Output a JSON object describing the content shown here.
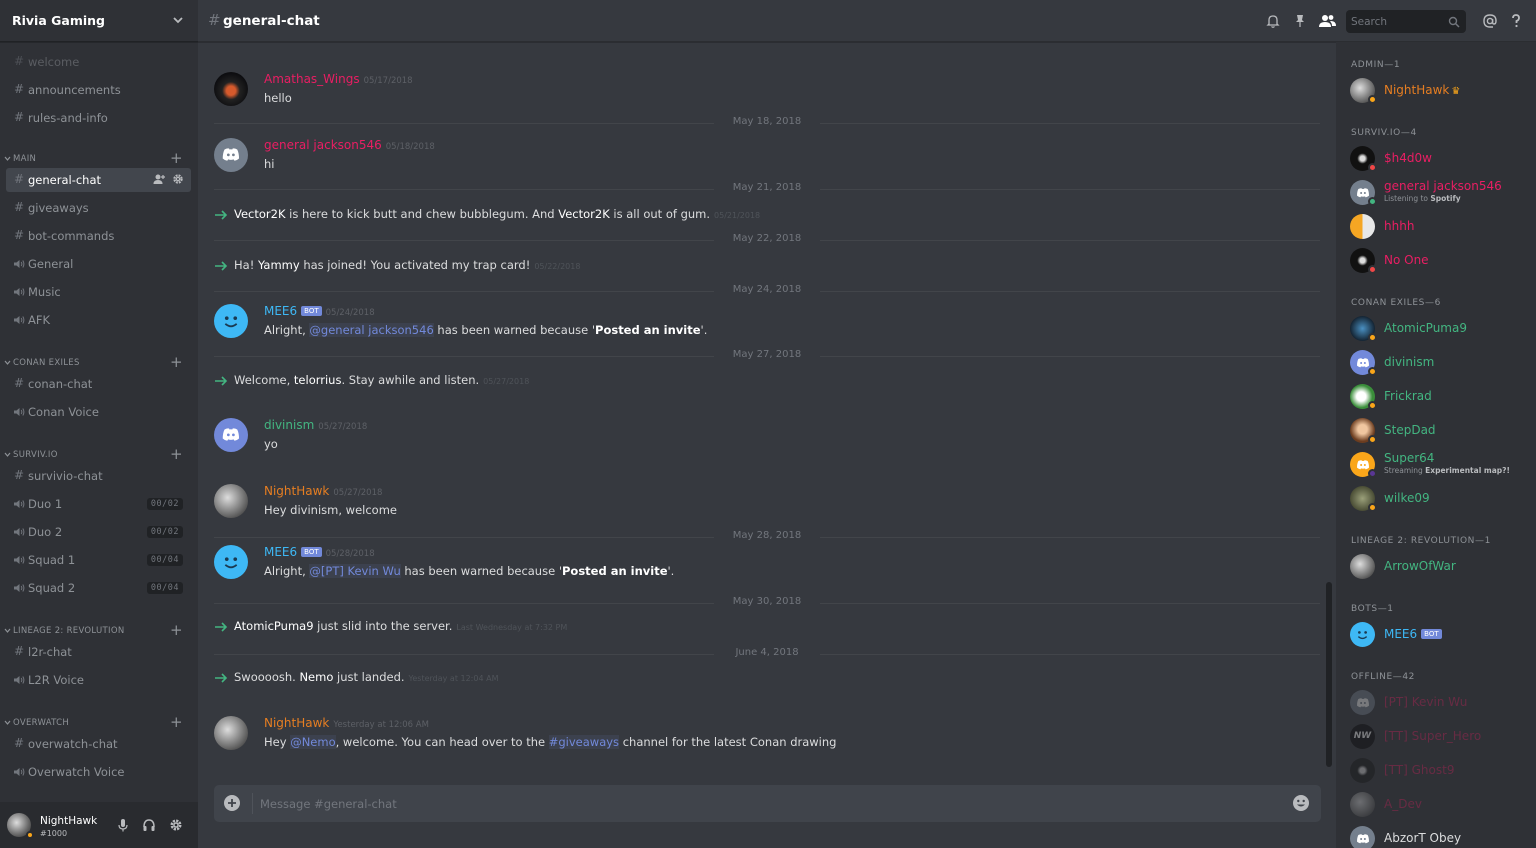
{
  "server": {
    "name": "Rivia Gaming"
  },
  "sidebar": {
    "partial_channel": "welcome",
    "top_channels": [
      {
        "name": "announcements",
        "type": "text"
      },
      {
        "name": "rules-and-info",
        "type": "text"
      }
    ],
    "categories": [
      {
        "name": "MAIN",
        "channels": [
          {
            "name": "general-chat",
            "type": "text",
            "active": true
          },
          {
            "name": "giveaways",
            "type": "text"
          },
          {
            "name": "bot-commands",
            "type": "text"
          },
          {
            "name": "General",
            "type": "voice"
          },
          {
            "name": "Music",
            "type": "voice"
          },
          {
            "name": "AFK",
            "type": "voice"
          }
        ]
      },
      {
        "name": "CONAN EXILES",
        "channels": [
          {
            "name": "conan-chat",
            "type": "text"
          },
          {
            "name": "Conan Voice",
            "type": "voice"
          }
        ]
      },
      {
        "name": "SURVIV.IO",
        "channels": [
          {
            "name": "survivio-chat",
            "type": "text"
          },
          {
            "name": "Duo 1",
            "type": "voice",
            "count": "00/02"
          },
          {
            "name": "Duo 2",
            "type": "voice",
            "count": "00/02"
          },
          {
            "name": "Squad 1",
            "type": "voice",
            "count": "00/04"
          },
          {
            "name": "Squad 2",
            "type": "voice",
            "count": "00/04"
          }
        ]
      },
      {
        "name": "LINEAGE 2: REVOLUTION",
        "channels": [
          {
            "name": "l2r-chat",
            "type": "text"
          },
          {
            "name": "L2R Voice",
            "type": "voice"
          }
        ]
      },
      {
        "name": "OVERWATCH",
        "channels": [
          {
            "name": "overwatch-chat",
            "type": "text"
          },
          {
            "name": "Overwatch Voice",
            "type": "voice"
          }
        ]
      }
    ]
  },
  "user": {
    "name": "NightHawk",
    "tag": "#1000",
    "status_color": "#faa61a"
  },
  "topbar": {
    "hash": "#",
    "channel": "general-chat",
    "search_placeholder": "Search"
  },
  "messages": [
    {
      "kind": "msg",
      "author": "Amathas_Wings",
      "color": "#e91e63",
      "time": "05/17/2018",
      "text": "hello",
      "avatar": "photo-dark"
    },
    {
      "kind": "divider",
      "label": "May 18, 2018"
    },
    {
      "kind": "msg",
      "author": "general jackson546",
      "color": "#e91e63",
      "time": "05/18/2018",
      "text": "hi",
      "avatar": "discord-grey"
    },
    {
      "kind": "divider",
      "label": "May 21, 2018"
    },
    {
      "kind": "sys",
      "parts": [
        "",
        "Vector2K",
        " is here to kick butt and chew bubblegum. And ",
        "Vector2K",
        " is all out of gum."
      ],
      "time": "05/21/2018"
    },
    {
      "kind": "divider",
      "label": "May 22, 2018"
    },
    {
      "kind": "sys",
      "parts": [
        "Ha! ",
        "Yammy",
        " has joined! You activated my trap card!",
        "",
        ""
      ],
      "time": "05/22/2018"
    },
    {
      "kind": "divider",
      "label": "May 24, 2018"
    },
    {
      "kind": "msg",
      "author": "MEE6",
      "bot": "BOT",
      "color": "#3eb8f5",
      "time": "05/24/2018",
      "avatar": "mee6",
      "pre": "Alright, ",
      "mention": "@general jackson546",
      "post": " has been warned because '",
      "bold": "Posted an invite",
      "end": "'."
    },
    {
      "kind": "divider",
      "label": "May 27, 2018"
    },
    {
      "kind": "sys",
      "parts": [
        "Welcome, ",
        "telorrius",
        ". Stay awhile and listen.",
        "",
        ""
      ],
      "time": "05/27/2018"
    },
    {
      "kind": "msg",
      "author": "divinism",
      "color": "#43b581",
      "time": "05/27/2018",
      "text": "yo",
      "avatar": "discord-blurple"
    },
    {
      "kind": "msg",
      "author": "NightHawk",
      "color": "#e67e22",
      "time": "05/27/2018",
      "text": "Hey divinism, welcome",
      "avatar": "photo-grey"
    },
    {
      "kind": "divider",
      "label": "May 28, 2018"
    },
    {
      "kind": "msg",
      "author": "MEE6",
      "bot": "BOT",
      "color": "#3eb8f5",
      "time": "05/28/2018",
      "avatar": "mee6",
      "pre": "Alright, ",
      "mention": "@[PT] Kevin Wu",
      "post": " has been warned because '",
      "bold": "Posted an invite",
      "end": "'."
    },
    {
      "kind": "divider",
      "label": "May 30, 2018"
    },
    {
      "kind": "sys",
      "parts": [
        "",
        "AtomicPuma9",
        " just slid into the server.",
        "",
        ""
      ],
      "time": "Last Wednesday at 7:32 PM"
    },
    {
      "kind": "divider",
      "label": "June 4, 2018"
    },
    {
      "kind": "sys",
      "parts": [
        "Swoooosh. ",
        "Nemo",
        " just landed.",
        "",
        ""
      ],
      "time": "Yesterday at 12:04 AM"
    },
    {
      "kind": "msg",
      "author": "NightHawk",
      "color": "#e67e22",
      "time": "Yesterday at 12:06 AM",
      "avatar": "photo-grey",
      "pre": "Hey ",
      "mention": "@Nemo",
      "post": ", welcome. You can head over to the ",
      "mention2": "#giveaways",
      "end": " channel for the latest Conan drawing"
    }
  ],
  "composer": {
    "placeholder": "Message #general-chat"
  },
  "members": {
    "groups": [
      {
        "title": "ADMIN—1",
        "members": [
          {
            "name": "NightHawk",
            "color": "#e67e22",
            "status": "#faa61a",
            "crown": "♛",
            "avatar": "photo-grey"
          }
        ]
      },
      {
        "title": "SURVIV.IO—4",
        "members": [
          {
            "name": "$h4d0w",
            "color": "#e91e63",
            "status": "#f04747",
            "avatar": "dark"
          },
          {
            "name": "general jackson546",
            "color": "#e91e63",
            "status": "#43b581",
            "avatar": "discord-grey",
            "activity_pre": "Listening to ",
            "activity": "Spotify"
          },
          {
            "name": "hhhh",
            "color": "#e91e63",
            "status": "",
            "avatar": "orange"
          },
          {
            "name": "No One",
            "color": "#e91e63",
            "status": "#f04747",
            "avatar": "dark"
          }
        ]
      },
      {
        "title": "CONAN EXILES—6",
        "members": [
          {
            "name": "AtomicPuma9",
            "color": "#43b581",
            "status": "#faa61a",
            "avatar": "navy"
          },
          {
            "name": "divinism",
            "color": "#43b581",
            "status": "#faa61a",
            "avatar": "discord-blurple"
          },
          {
            "name": "Frickrad",
            "color": "#43b581",
            "status": "#faa61a",
            "avatar": "photo-green"
          },
          {
            "name": "StepDad",
            "color": "#43b581",
            "status": "#faa61a",
            "avatar": "photo-brown"
          },
          {
            "name": "Super64",
            "color": "#43b581",
            "status": "#593695",
            "avatar": "discord-orange",
            "activity_pre": "Streaming ",
            "activity": "Experimental map?!"
          },
          {
            "name": "wilke09",
            "color": "#43b581",
            "status": "#faa61a",
            "avatar": "photo-olive"
          }
        ]
      },
      {
        "title": "LINEAGE 2: REVOLUTION—1",
        "members": [
          {
            "name": "ArrowOfWar",
            "color": "#43b581",
            "status": "",
            "avatar": "photo-grey"
          }
        ]
      },
      {
        "title": "BOTS—1",
        "members": [
          {
            "name": "MEE6",
            "color": "#3eb8f5",
            "status": "",
            "avatar": "mee6",
            "bot": "BOT"
          }
        ]
      },
      {
        "title": "OFFLINE—42",
        "members": [
          {
            "name": "[PT] Kevin Wu",
            "color": "#e91e63",
            "offline": true,
            "avatar": "discord-grey"
          },
          {
            "name": "[TT] Super_Hero",
            "color": "#e91e63",
            "offline": true,
            "avatar": "nw"
          },
          {
            "name": "[TT] Ghost9",
            "color": "#e91e63",
            "offline": true,
            "avatar": "dark"
          },
          {
            "name": "A_Dev",
            "color": "#e91e63",
            "offline": true,
            "avatar": "photo-grey"
          },
          {
            "name": "AbzorT Obey",
            "color": "#dcddde",
            "offline": false,
            "avatar": "discord-grey"
          }
        ]
      }
    ]
  }
}
